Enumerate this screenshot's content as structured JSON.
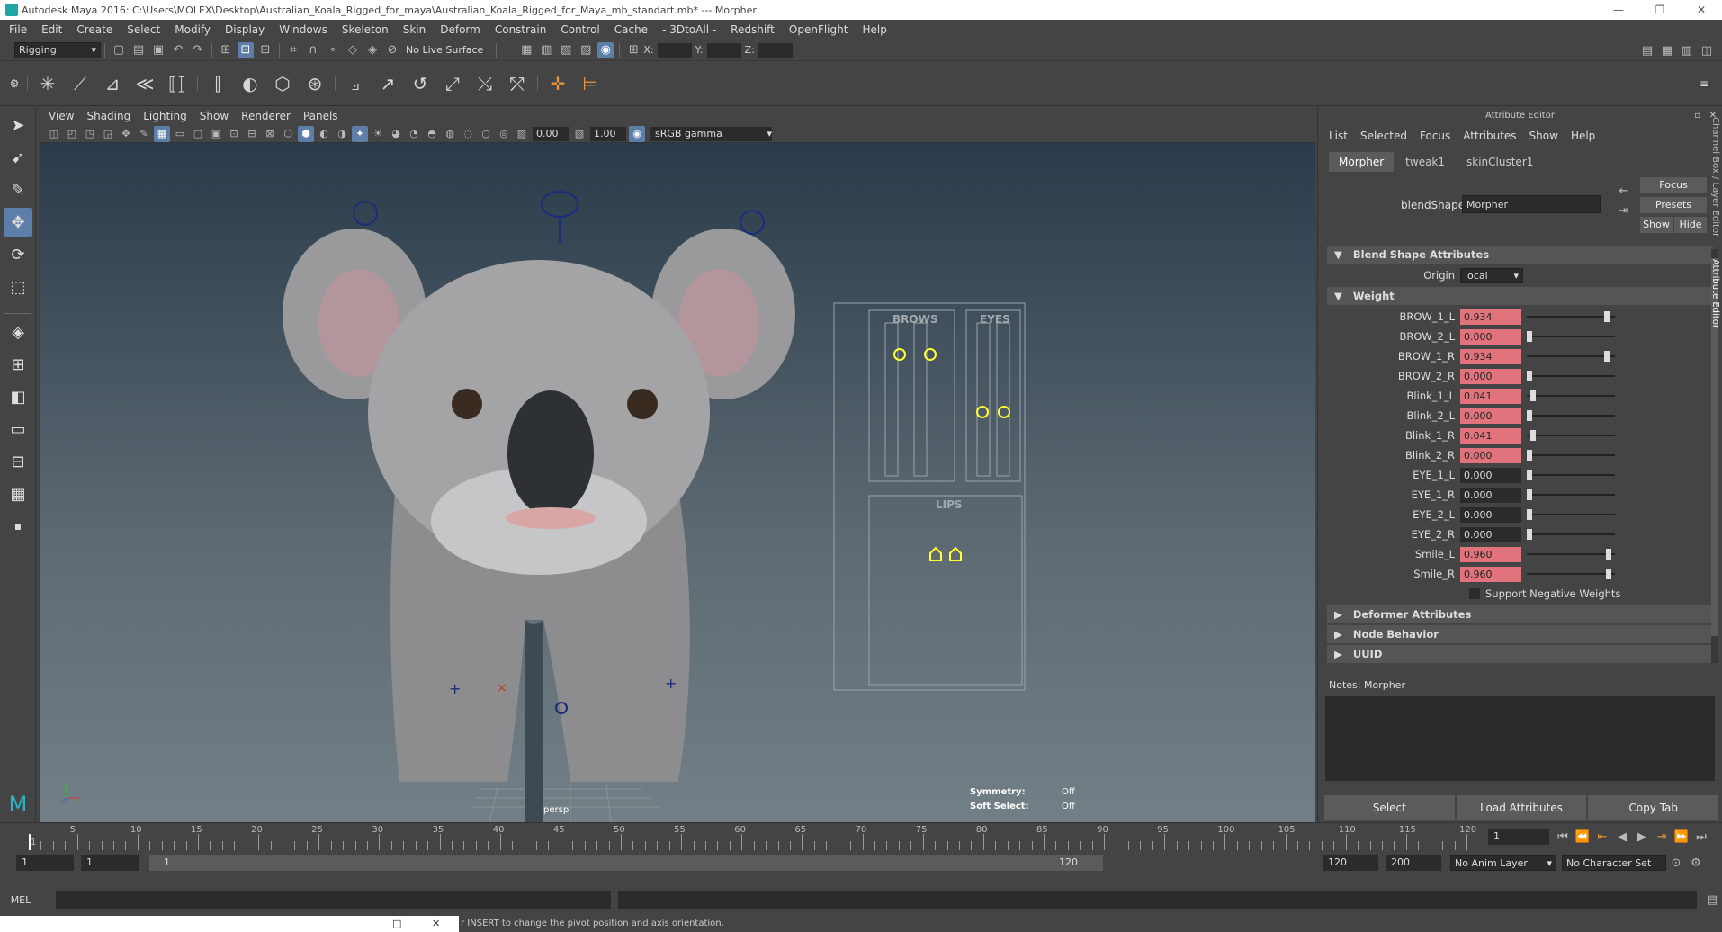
{
  "window": {
    "title": "Autodesk Maya 2016: C:\\Users\\MOLEX\\Desktop\\Australian_Koala_Rigged_for_maya\\Australian_Koala_Rigged_for_Maya_mb_standart.mb*   ---   Morpher"
  },
  "menubar": [
    "File",
    "Edit",
    "Create",
    "Select",
    "Modify",
    "Display",
    "Windows",
    "Skeleton",
    "Skin",
    "Deform",
    "Constrain",
    "Control",
    "Cache",
    "- 3DtoAll -",
    "Redshift",
    "OpenFlight",
    "Help"
  ],
  "statusline": {
    "menuset": "Rigging",
    "live_surface": "No Live Surface",
    "x_label": "X:",
    "y_label": "Y:",
    "z_label": "Z:"
  },
  "viewport": {
    "menus": [
      "View",
      "Shading",
      "Lighting",
      "Show",
      "Renderer",
      "Panels"
    ],
    "exposure": "0.00",
    "gamma_value": "1.00",
    "colorspace": "sRGB gamma",
    "camera": "persp",
    "hud": {
      "symmetry_label": "Symmetry:",
      "symmetry_value": "Off",
      "soft_select_label": "Soft Select:",
      "soft_select_value": "Off"
    },
    "picker": {
      "brows": "BROWS",
      "eyes": "EYES",
      "lips": "LIPS"
    }
  },
  "attribute_editor": {
    "header": "Attribute Editor",
    "menus": [
      "List",
      "Selected",
      "Focus",
      "Attributes",
      "Show",
      "Help"
    ],
    "tabs": [
      "Morpher",
      "tweak1",
      "skinCluster1"
    ],
    "blendshape_label": "blendShape:",
    "blendshape_value": "Morpher",
    "focus_btn": "Focus",
    "presets_btn": "Presets",
    "show_btn": "Show",
    "hide_btn": "Hide",
    "section_blend": "Blend Shape Attributes",
    "origin_label": "Origin",
    "origin_value": "local",
    "section_weight": "Weight",
    "weights": [
      {
        "name": "BROW_1_L",
        "value": "0.934",
        "v": 0.934,
        "keyed": true
      },
      {
        "name": "BROW_2_L",
        "value": "0.000",
        "v": 0.0,
        "keyed": true
      },
      {
        "name": "BROW_1_R",
        "value": "0.934",
        "v": 0.934,
        "keyed": true
      },
      {
        "name": "BROW_2_R",
        "value": "0.000",
        "v": 0.0,
        "keyed": true
      },
      {
        "name": "Blink_1_L",
        "value": "0.041",
        "v": 0.041,
        "keyed": true
      },
      {
        "name": "Blink_2_L",
        "value": "0.000",
        "v": 0.0,
        "keyed": true
      },
      {
        "name": "Blink_1_R",
        "value": "0.041",
        "v": 0.041,
        "keyed": true
      },
      {
        "name": "Blink_2_R",
        "value": "0.000",
        "v": 0.0,
        "keyed": true
      },
      {
        "name": "EYE_1_L",
        "value": "0.000",
        "v": 0.0,
        "keyed": false
      },
      {
        "name": "EYE_1_R",
        "value": "0.000",
        "v": 0.0,
        "keyed": false
      },
      {
        "name": "EYE_2_L",
        "value": "0.000",
        "v": 0.0,
        "keyed": false
      },
      {
        "name": "EYE_2_R",
        "value": "0.000",
        "v": 0.0,
        "keyed": false
      },
      {
        "name": "Smile_L",
        "value": "0.960",
        "v": 0.96,
        "keyed": true
      },
      {
        "name": "Smile_R",
        "value": "0.960",
        "v": 0.96,
        "keyed": true
      }
    ],
    "support_negative": "Support Negative Weights",
    "sections_collapsed": [
      "Deformer Attributes",
      "Node Behavior",
      "UUID"
    ],
    "notes_label": "Notes:  Morpher",
    "buttons": [
      "Select",
      "Load Attributes",
      "Copy Tab"
    ],
    "side_tabs": [
      "Channel Box / Layer Editor",
      "Attribute Editor"
    ]
  },
  "timeline": {
    "ticks": [
      1,
      5,
      10,
      15,
      20,
      25,
      30,
      35,
      40,
      45,
      50,
      55,
      60,
      65,
      70,
      75,
      80,
      85,
      90,
      95,
      100,
      105,
      110,
      115,
      120
    ],
    "current_frame": "1"
  },
  "range": {
    "start": "1",
    "start2": "1",
    "range_start": "1",
    "range_end": "120",
    "end": "120",
    "end2": "200",
    "anim_layer": "No Anim Layer",
    "char_set": "No Character Set"
  },
  "cmd": {
    "label": "MEL"
  },
  "help": {
    "text": "r INSERT to change the pivot position and axis orientation."
  }
}
